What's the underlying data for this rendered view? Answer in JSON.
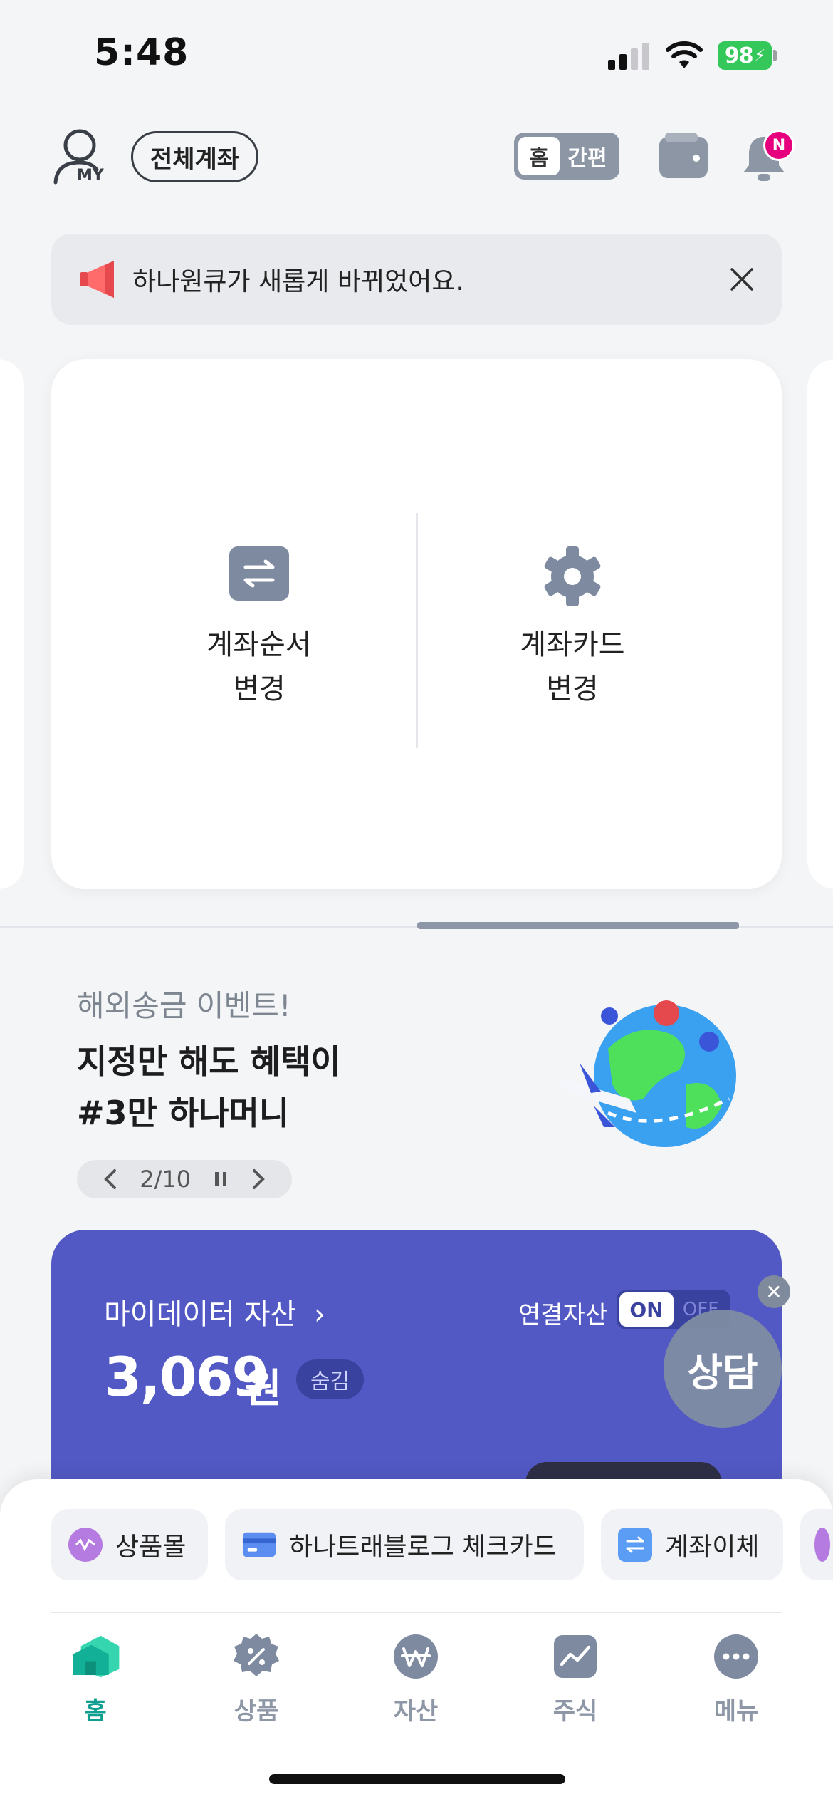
{
  "status_bar": {
    "time": "5:48",
    "battery": "98"
  },
  "header": {
    "my_label": "MY",
    "all_accounts": "전체계좌",
    "mode_home": "홈",
    "mode_simple": "간편",
    "notification_badge": "N"
  },
  "notice": {
    "text": "하나원큐가 새롭게 바뀌었어요."
  },
  "account_actions": [
    {
      "line1": "계좌순서",
      "line2": "변경",
      "icon": "transfer-arrows-icon"
    },
    {
      "line1": "계좌카드",
      "line2": "변경",
      "icon": "gear-icon"
    }
  ],
  "event": {
    "subtitle": "해외송금 이벤트!",
    "title_line1": "지정만 해도 혜택이",
    "title_line2": "#3만 하나머니",
    "pager": "2/10"
  },
  "mydata": {
    "title": "마이데이터 자산",
    "amount": "3,069",
    "unit": "원",
    "hide": "숨김",
    "linked_label": "연결자산",
    "toggle_on": "ON",
    "toggle_off": "OFF",
    "accent": "#5259c4"
  },
  "consult": {
    "label": "상담"
  },
  "quick_menu": [
    {
      "label": "상품몰",
      "icon": "purple-coin-icon"
    },
    {
      "label": "하나트래블로그 체크카드",
      "icon": "card-icon"
    },
    {
      "label": "계좌이체",
      "icon": "transfer-icon"
    }
  ],
  "bottom_nav": [
    {
      "label": "홈",
      "active": true
    },
    {
      "label": "상품",
      "active": false
    },
    {
      "label": "자산",
      "active": false
    },
    {
      "label": "주식",
      "active": false
    },
    {
      "label": "메뉴",
      "active": false
    }
  ],
  "colors": {
    "brand_teal": "#0f9e8f",
    "badge": "#e6007e",
    "battery": "#34c759"
  }
}
